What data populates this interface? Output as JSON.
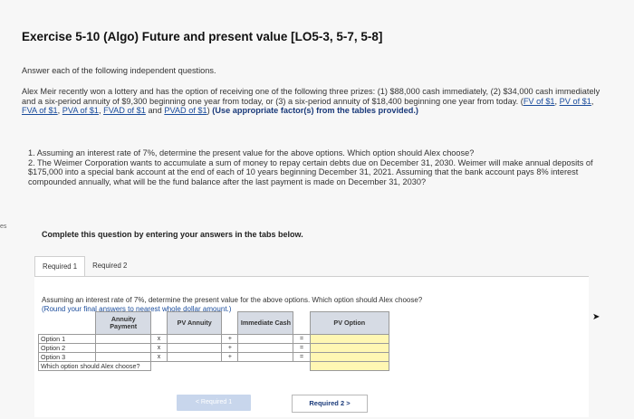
{
  "side_label": "es",
  "title": "Exercise 5-10 (Algo) Future and present value [LO5-3, 5-7, 5-8]",
  "intro": "Answer each of the following independent questions.",
  "problem": {
    "text1": "Alex Meir recently won a lottery and has the option of receiving one of the following three prizes: (1) $88,000 cash immediately, (2) $34,000 cash immediately and a six-period annuity of $9,300 beginning one year from today, or (3) a six-period annuity of $18,400 beginning one year from today. (",
    "links": [
      "FV of $1",
      "PV of $1",
      "FVA of $1",
      "PVA of $1",
      "FVAD of $1",
      "PVAD of $1"
    ],
    "bold_tail": "(Use appropriate factor(s) from the tables provided.)"
  },
  "questions": {
    "q1": "1. Assuming an interest rate of 7%, determine the present value for the above options. Which option should Alex choose?",
    "q2": "2. The Weimer Corporation wants to accumulate a sum of money to repay certain debts due on December 31, 2030. Weimer will make annual deposits of $175,000 into a special bank account at the end of each of 10 years beginning December 31, 2021. Assuming that the bank account pays 8% interest compounded annually, what will be the fund balance after the last payment is made on December 31, 2030?"
  },
  "complete": "Complete this question by entering your answers in the tabs below.",
  "tabs": [
    "Required 1",
    "Required 2"
  ],
  "panel": {
    "question": "Assuming an interest rate of 7%, determine the present value for the above options. Which option should Alex choose?",
    "hint": "(Round your final answers to nearest whole dollar amount.)"
  },
  "table": {
    "headers": [
      "Annuity Payment",
      "PV Annuity",
      "Immediate Cash",
      "PV Option"
    ],
    "rows": [
      "Option 1",
      "Option 2",
      "Option 3",
      "Which option should Alex choose?"
    ],
    "op_mult": "x",
    "op_plus": "+",
    "op_eq": "="
  },
  "buttons": {
    "prev": "< Required 1",
    "next": "Required 2 >"
  },
  "colors": {
    "link": "#1a4c9c",
    "input_yellow": "#fff7b3",
    "header_bg": "#d6dbe4"
  }
}
